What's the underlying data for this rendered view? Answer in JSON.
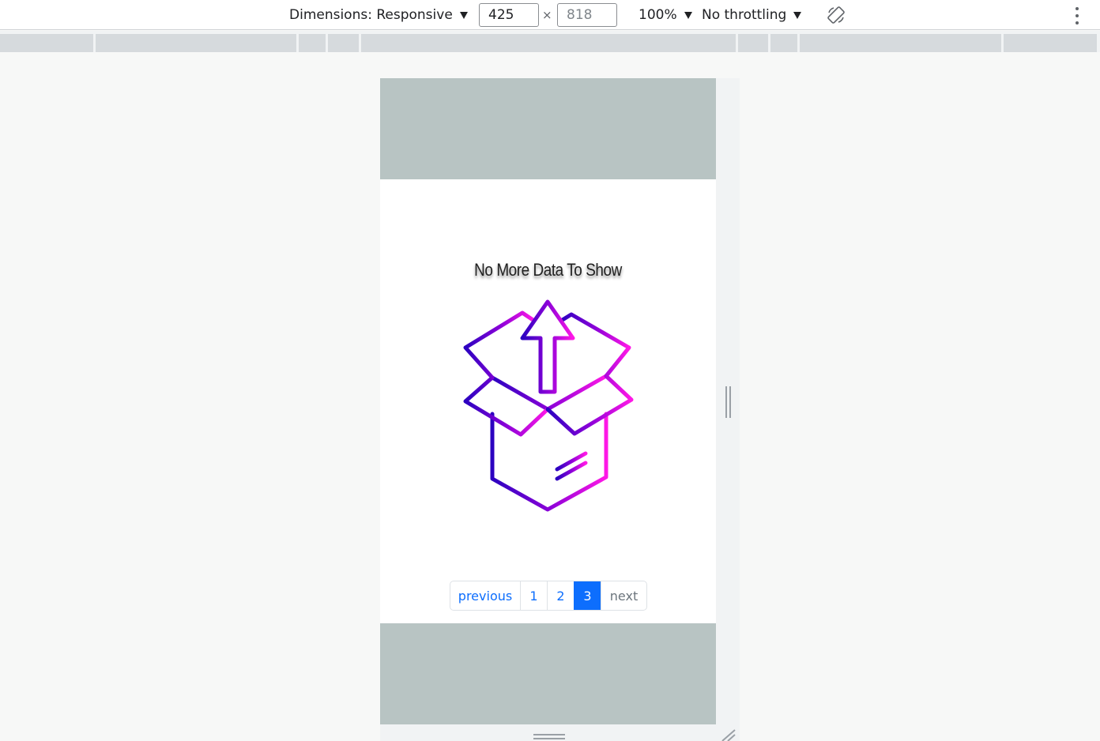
{
  "devtools": {
    "dimensions_label": "Dimensions: Responsive",
    "width_value": "425",
    "height_placeholder": "818",
    "times_sign": "×",
    "zoom_label": "100%",
    "throttling_label": "No throttling",
    "rotate_icon": "rotate-icon",
    "menu_icon": "more-vert-icon"
  },
  "page": {
    "message": "No More Data To Show",
    "illustration": "open-box-arrow-icon",
    "colors": {
      "banner": "#b8c4c3",
      "gradient_start": "#2b00c0",
      "gradient_end": "#ff18e6",
      "link": "#0d6efd",
      "active": "#0d6efd"
    },
    "pagination": {
      "previous_label": "previous",
      "pages": [
        "1",
        "2",
        "3"
      ],
      "active_page": "3",
      "next_label": "next",
      "next_disabled": true
    }
  }
}
